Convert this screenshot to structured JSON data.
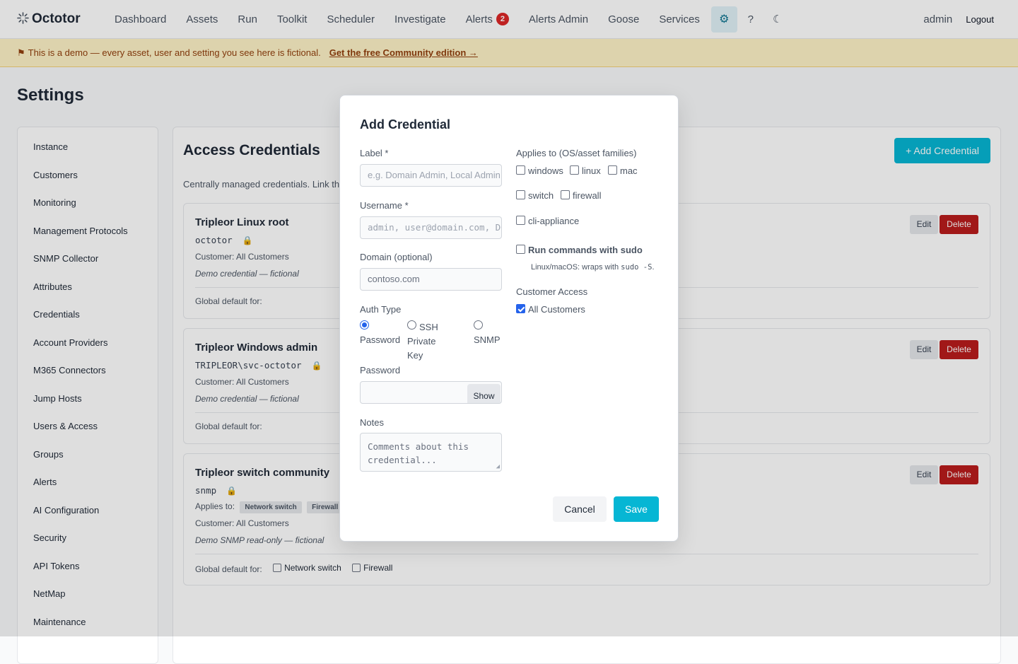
{
  "nav": {
    "brand_icon": "spark-icon",
    "brand": "Octotor",
    "links": [
      "Dashboard",
      "Assets",
      "Run",
      "Toolkit",
      "Scheduler",
      "Investigate",
      "Alerts",
      "Alerts Admin",
      "Goose",
      "Services"
    ],
    "alerts_badge": "2",
    "gear": "⚙",
    "help": "?",
    "theme": "☾",
    "user": "admin",
    "logout": "Logout"
  },
  "banner": {
    "flag": "⚑",
    "text": "This is a demo — every asset, user and setting you see here is fictional.",
    "link": "Get the free Community edition →"
  },
  "page": {
    "title": "Settings"
  },
  "sidebar": {
    "items": [
      "Instance",
      "Customers",
      "Monitoring",
      "Management Protocols",
      "SNMP Collector",
      "Attributes",
      "Credentials",
      "Account Providers",
      "M365 Connectors",
      "Jump Hosts",
      "Users & Access",
      "Groups",
      "Alerts",
      "AI Configuration",
      "Security",
      "API Tokens",
      "NetMap",
      "Maintenance"
    ]
  },
  "main": {
    "title": "Access Credentials",
    "add_button": "+ Add Credential",
    "description": "Centrally managed credentials. Link th",
    "edit_label": "Edit",
    "delete_label": "Delete",
    "lock": "🔒",
    "global_default_label": "Global default for:",
    "applies_to_label": "Applies to:",
    "credentials": [
      {
        "name": "Tripleor Linux root",
        "user": "octotor",
        "customer": "Customer: All Customers",
        "note": "Demo credential — fictional"
      },
      {
        "name": "Tripleor Windows admin",
        "user": "TRIPLEOR\\svc-octotor",
        "customer": "Customer: All Customers",
        "note": "Demo credential — fictional"
      },
      {
        "name": "Tripleor switch community",
        "user": "snmp",
        "customer": "Customer: All Customers",
        "note": "Demo SNMP read-only — fictional",
        "tags": [
          "Network switch",
          "Firewall"
        ],
        "defaults": [
          "Network switch",
          "Firewall"
        ]
      }
    ]
  },
  "modal": {
    "title": "Add Credential",
    "label_label": "Label *",
    "label_placeholder": "e.g. Domain Admin, Local Admin",
    "username_label": "Username *",
    "username_placeholder": "admin, user@domain.com, DOMAIN\\user",
    "domain_label": "Domain (optional)",
    "domain_placeholder": "contoso.com",
    "auth_type_label": "Auth Type",
    "auth_options": [
      "Password",
      "SSH Private Key",
      "SNMP"
    ],
    "auth_selected": "Password",
    "password_label": "Password",
    "password_value": "",
    "show_label": "Show",
    "notes_label": "Notes",
    "notes_placeholder": "Comments about this credential...",
    "applies_label": "Applies to (OS/asset families)",
    "families": [
      "windows",
      "linux",
      "mac",
      "switch",
      "firewall",
      "cli-appliance"
    ],
    "sudo_label": "Run commands with sudo",
    "sudo_hint_prefix": "Linux/macOS: wraps with",
    "sudo_hint_code": "sudo -S",
    "sudo_hint_suffix": ".",
    "customer_access_label": "Customer Access",
    "all_customers_label": "All Customers",
    "all_customers_checked": true,
    "cancel": "Cancel",
    "save": "Save"
  }
}
